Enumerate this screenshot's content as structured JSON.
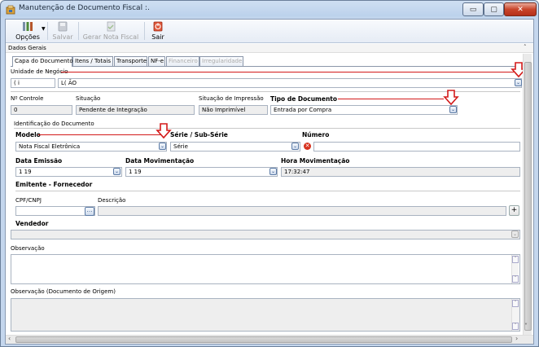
{
  "window": {
    "title": "Manutenção de Documento Fiscal :.",
    "min_glyph": "▭",
    "max_glyph": "▢",
    "close_glyph": "✕"
  },
  "toolbar": {
    "opcoes": "Opções",
    "salvar": "Salvar",
    "gerar": "Gerar Nota Fiscal",
    "sair": "Sair"
  },
  "panel": {
    "header": "Dados Gerais"
  },
  "tabs": [
    {
      "label": "Capa do Documento",
      "active": true,
      "enabled": true
    },
    {
      "label": "Itens / Totais",
      "enabled": true
    },
    {
      "label": "Transporte",
      "enabled": true
    },
    {
      "label": "NF-e",
      "enabled": true
    },
    {
      "label": "Financeiro",
      "enabled": false
    },
    {
      "label": "Irregularidade",
      "enabled": false
    }
  ],
  "form": {
    "unidade_label": "Unidade de Negócio",
    "unidade_code": "(          i",
    "unidade_name": "L(                              ÃO",
    "controle_label": "Nº Controle",
    "controle_value": "0",
    "situacao_label": "Situação",
    "situacao_value": "Pendente de Integração",
    "sit_impressao_label": "Situação de Impressão",
    "sit_impressao_value": "Não Imprimível",
    "tipo_doc_label": "Tipo de Documento",
    "tipo_doc_value": "Entrada por Compra",
    "ident_label": "Identificação do Documento",
    "modelo_label": "Modelo",
    "modelo_value": "Nota Fiscal Eletrônica",
    "serie_label": "Série / Sub-Série",
    "serie_value": "Série",
    "numero_label": "Número",
    "numero_value": "",
    "data_emissao_label": "Data Emissão",
    "data_emissao_value": "1          19",
    "data_mov_label": "Data Movimentação",
    "data_mov_value": "1          19",
    "hora_mov_label": "Hora Movimentação",
    "hora_mov_value": "17:32:47",
    "emitente_label": "Emitente - Fornecedor",
    "cpf_label": "CPF/CNPJ",
    "descricao_label": "Descrição",
    "vendedor_label": "Vendedor",
    "observacao_label": "Observação",
    "obs_origem_label": "Observação (Documento de Origem)"
  },
  "icons": {
    "dropdown": "⌄",
    "lookup": "…",
    "plus": "+",
    "error": "✕",
    "scroll_up": "˄",
    "scroll_down": "˅",
    "scroll_left": "‹",
    "scroll_right": "›"
  },
  "colors": {
    "annotation": "#d31a1a",
    "error": "#d7321e"
  }
}
